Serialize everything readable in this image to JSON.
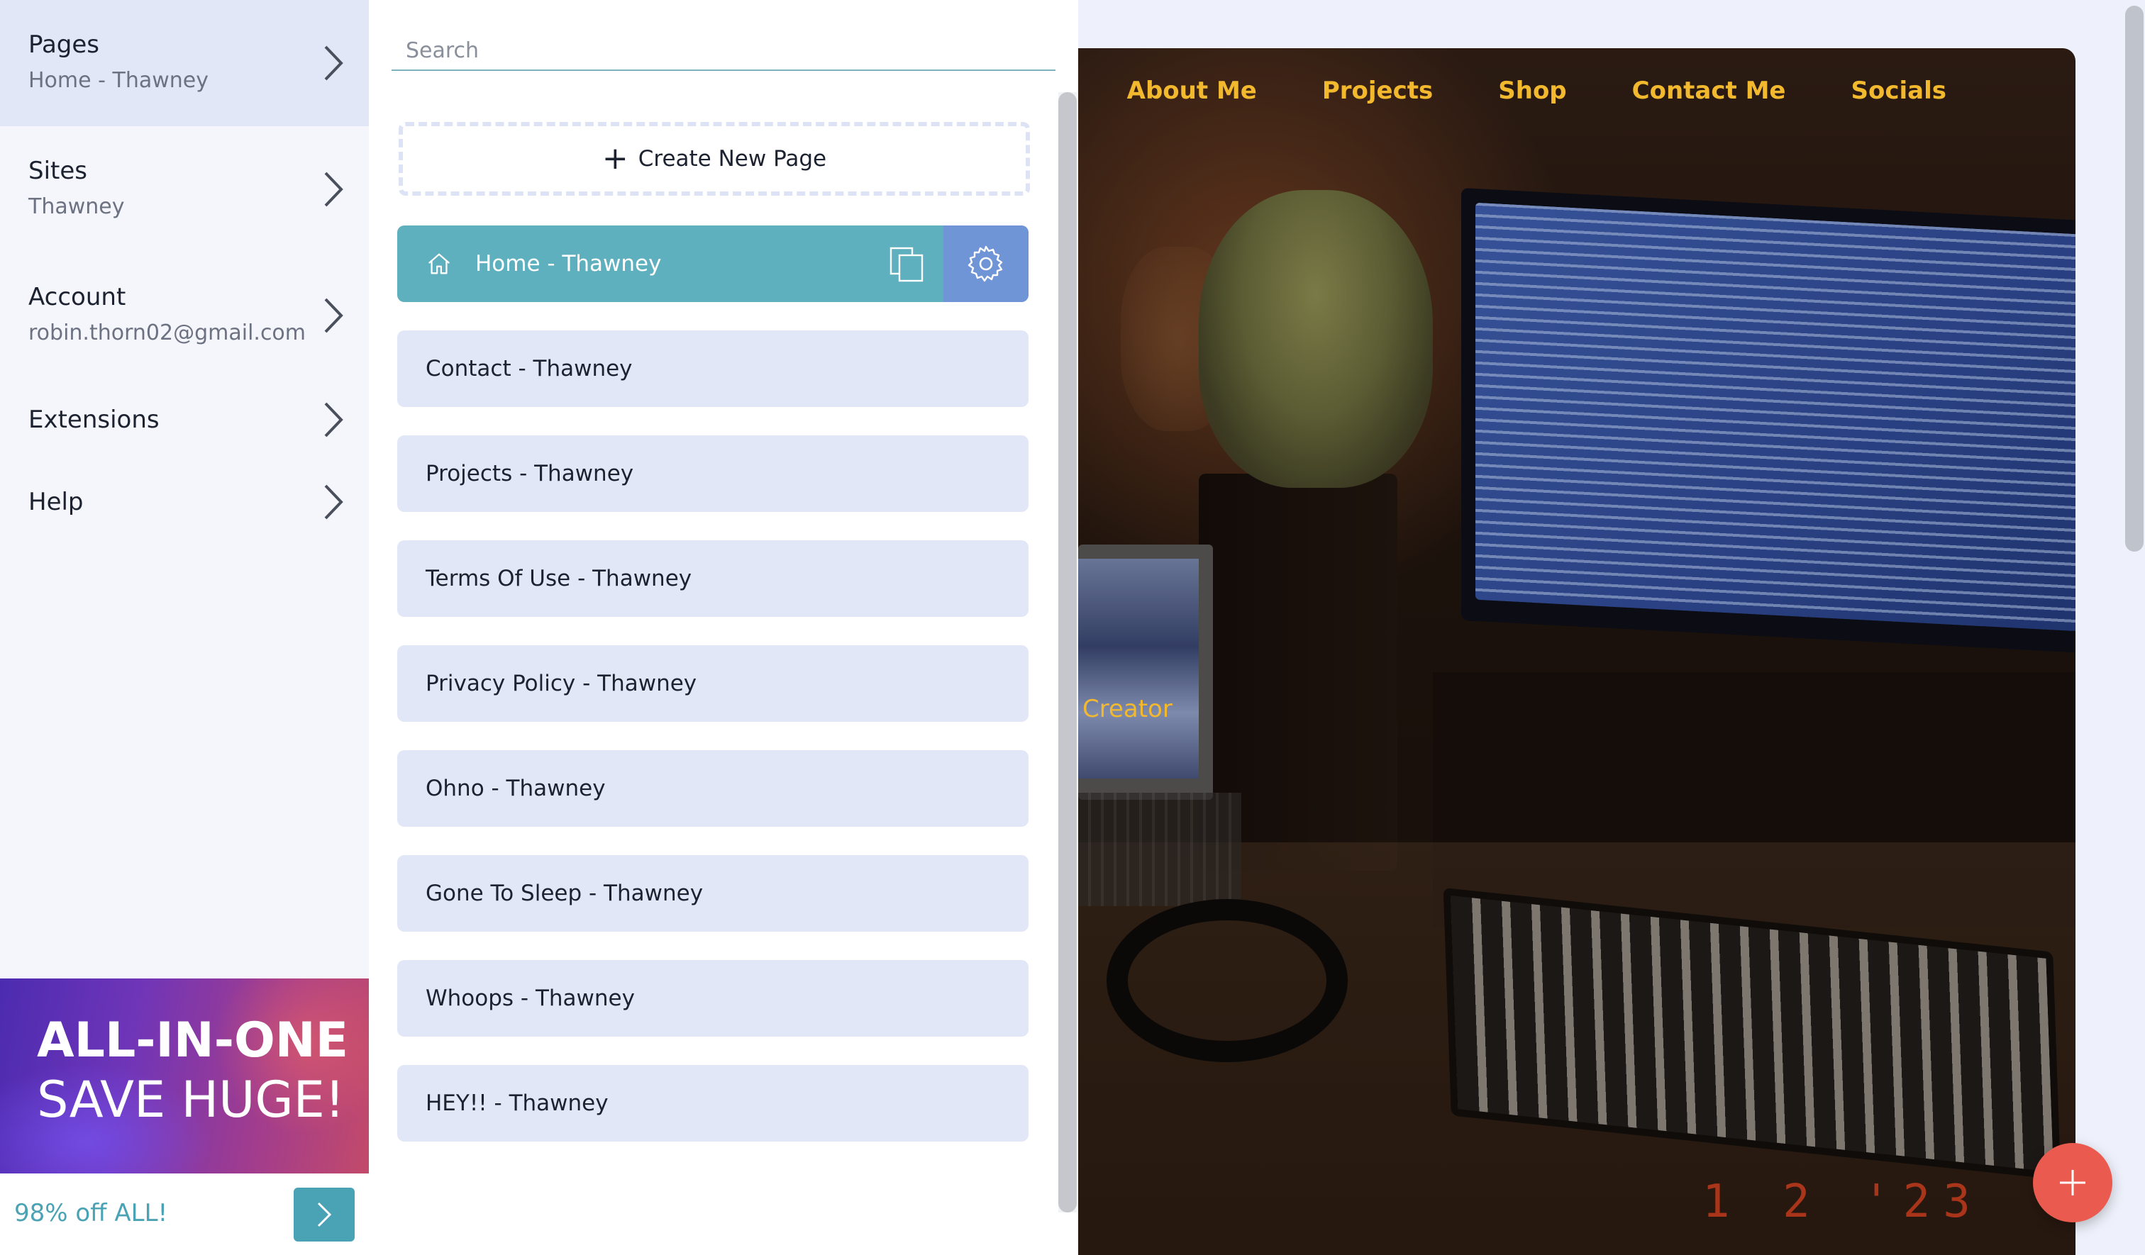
{
  "sidebar": {
    "items": [
      {
        "label": "Pages",
        "sub": "Home - Thawney",
        "icon": "chevron-right-icon"
      },
      {
        "label": "Sites",
        "sub": "Thawney",
        "icon": "chevron-right-icon"
      },
      {
        "label": "Account",
        "sub": "robin.thorn02@gmail.com",
        "icon": "chevron-right-icon"
      },
      {
        "label": "Extensions",
        "icon": "chevron-right-icon"
      },
      {
        "label": "Help",
        "icon": "chevron-right-icon"
      }
    ],
    "promo": {
      "line1": "ALL-IN-ONE",
      "line2": "SAVE HUGE!",
      "offer": "98% off ALL!",
      "arrow_icon": "chevron-right-icon"
    }
  },
  "pages_panel": {
    "search": {
      "placeholder": "Search",
      "value": ""
    },
    "create_label": "Create New Page",
    "pages": [
      {
        "label": "Home - Thawney",
        "active": true
      },
      {
        "label": "Contact - Thawney"
      },
      {
        "label": "Projects - Thawney"
      },
      {
        "label": "Terms Of Use - Thawney"
      },
      {
        "label": "Privacy Policy - Thawney"
      },
      {
        "label": "Ohno - Thawney"
      },
      {
        "label": "Gone To Sleep - Thawney"
      },
      {
        "label": "Whoops - Thawney"
      },
      {
        "label": "HEY!! - Thawney"
      }
    ]
  },
  "preview": {
    "nav_links": [
      "About Me",
      "Projects",
      "Shop",
      "Contact Me",
      "Socials"
    ],
    "hero_word": "Creator",
    "date_stamp": "1  2 '23",
    "fab_icon": "plus-icon"
  },
  "colors": {
    "accent": "#5fb0bf",
    "settings_button": "#6f95d6",
    "row_background": "#e2e7f8",
    "site_nav": "#f2b92f",
    "fab": "#ea5a4f",
    "promo_text": "#4aa3b5"
  }
}
